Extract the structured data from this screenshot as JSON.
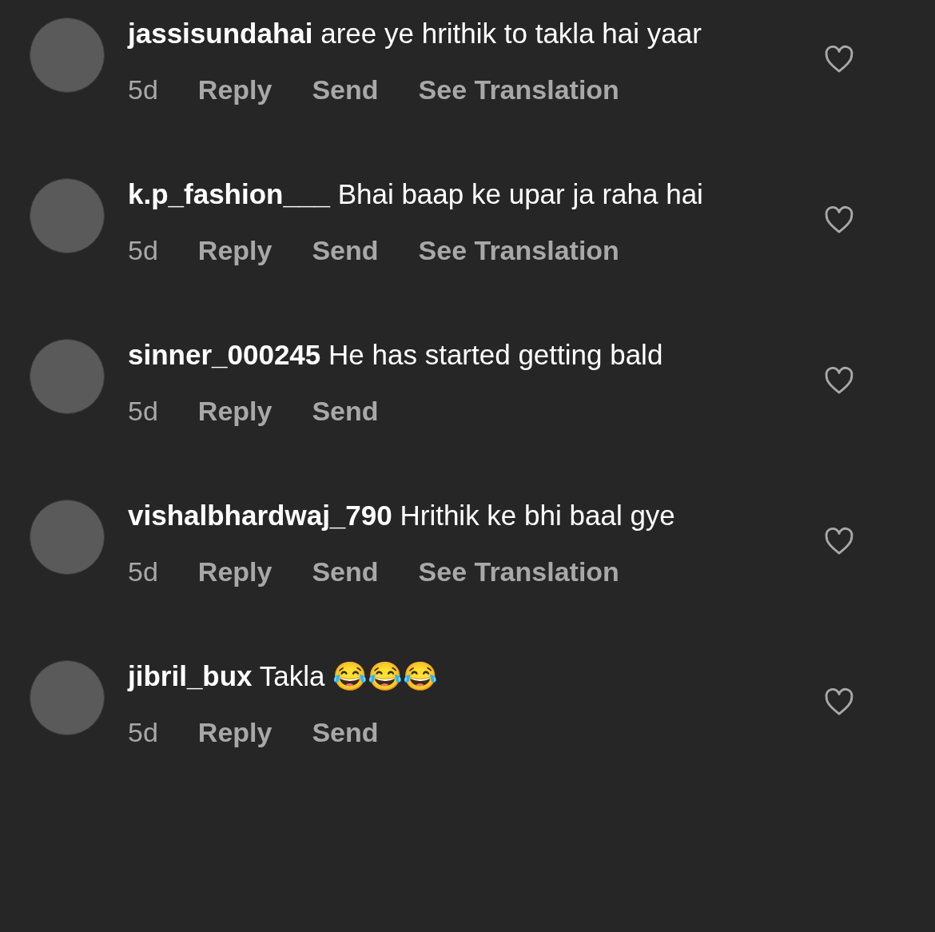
{
  "comments": [
    {
      "username": "jassisundahai",
      "text": "aree ye hrithik to takla hai yaar",
      "time": "5d",
      "actions": [
        "Reply",
        "Send",
        "See Translation"
      ],
      "liked": false
    },
    {
      "username": "k.p_fashion___",
      "text": "Bhai baap ke upar ja raha hai",
      "time": "5d",
      "actions": [
        "Reply",
        "Send",
        "See Translation"
      ],
      "liked": false
    },
    {
      "username": "sinner_000245",
      "text": "He has started getting bald",
      "time": "5d",
      "actions": [
        "Reply",
        "Send"
      ],
      "liked": false
    },
    {
      "username": "vishalbhardwaj_790",
      "text": "Hrithik ke bhi baal gye",
      "time": "5d",
      "actions": [
        "Reply",
        "Send",
        "See Translation"
      ],
      "liked": false
    },
    {
      "username": "jibril_bux",
      "text": "Takla 😂😂😂",
      "time": "5d",
      "actions": [
        "Reply",
        "Send"
      ],
      "liked": false
    }
  ]
}
